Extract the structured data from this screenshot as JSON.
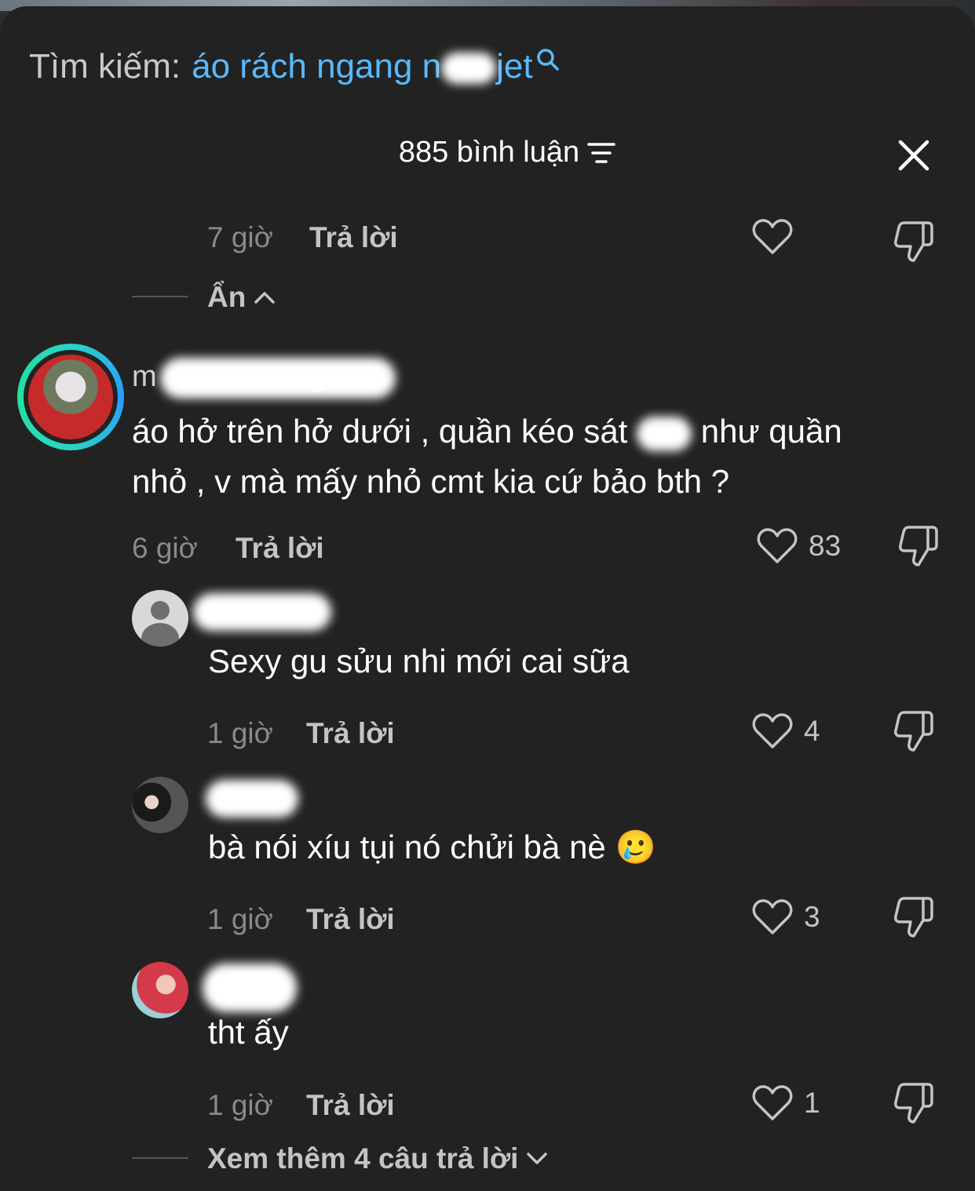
{
  "search": {
    "label": "Tìm kiếm:",
    "query": "áo rách ngang n",
    "query_tail": "jet"
  },
  "header": {
    "count_label": "885 bình luận"
  },
  "icons": {
    "close": "close-icon",
    "filter": "filter-icon",
    "like": "heart-icon",
    "dislike": "thumbs-down-icon",
    "search": "search-icon",
    "chevron_up": "chevron-up-icon",
    "chevron_down": "chevron-down-icon"
  },
  "colors": {
    "background": "#222222",
    "accent_blue": "#57b9ff",
    "text_muted": "#8a8a8a"
  },
  "top_reply": {
    "time": "7 giờ",
    "reply_label": "Trả lời"
  },
  "hide_toggle": {
    "label": "Ẩn"
  },
  "main_comment": {
    "username_visible": "m",
    "username_tail": "gam",
    "text_line1_a": "áo hở trên hở dưới , quần kéo sát",
    "text_line1_b": "như quần",
    "text_line2": "nhỏ , v mà mấy nhỏ cmt kia cứ bảo bth ?",
    "time": "6 giờ",
    "reply_label": "Trả lời",
    "likes": "83"
  },
  "replies": [
    {
      "text": "Sexy gu sửu nhi mới cai sữa",
      "time": "1 giờ",
      "reply_label": "Trả lời",
      "likes": "4"
    },
    {
      "text": "bà nói xíu tụi nó chửi bà nè",
      "emoji": "🥲",
      "time": "1 giờ",
      "reply_label": "Trả lời",
      "likes": "3"
    },
    {
      "text": "tht ấy",
      "time": "1 giờ",
      "reply_label": "Trả lời",
      "likes": "1"
    }
  ],
  "more_replies": {
    "label": "Xem thêm 4 câu trả lời"
  }
}
